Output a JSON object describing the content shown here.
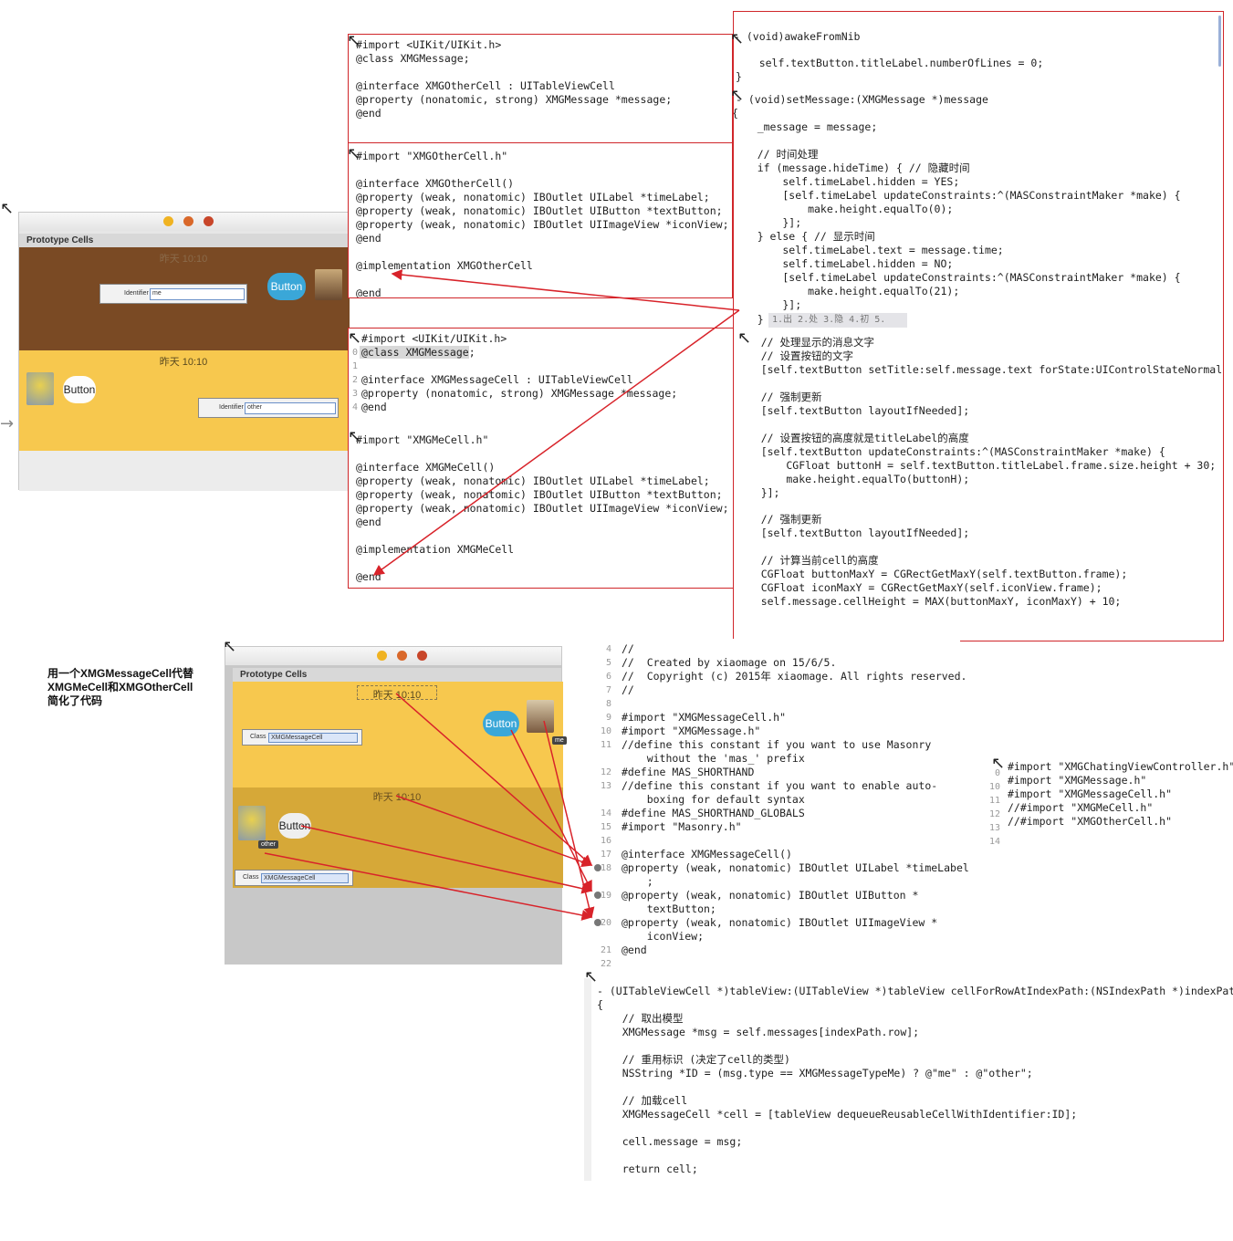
{
  "panel_othercell_header": {
    "lines": [
      "#import <UIKit/UIKit.h>",
      "@class XMGMessage;",
      "",
      "@interface XMGOtherCell : UITableViewCell",
      "@property (nonatomic, strong) XMGMessage *message;",
      "@end"
    ]
  },
  "panel_othercell_impl": {
    "lines": [
      "#import \"XMGOtherCell.h\"",
      "",
      "@interface XMGOtherCell()",
      "@property (weak, nonatomic) IBOutlet UILabel *timeLabel;",
      "@property (weak, nonatomic) IBOutlet UIButton *textButton;",
      "@property (weak, nonatomic) IBOutlet UIImageView *iconView;",
      "@end",
      "",
      "@implementation XMGOtherCell",
      "",
      "@end"
    ]
  },
  "panel_mecell": {
    "lines": [
      "#import <UIKit/UIKit.h>",
      "@class XMGMessage;",
      "",
      "@interface XMGMessageCell : UITableViewCell",
      "@property (nonatomic, strong) XMGMessage *message;",
      "@end",
      "",
      "#import \"XMGMeCell.h\"",
      "",
      "@interface XMGMeCell()",
      "@property (weak, nonatomic) IBOutlet UILabel *timeLabel;",
      "@property (weak, nonatomic) IBOutlet UIButton *textButton;",
      "@property (weak, nonatomic) IBOutlet UIImageView *iconView;",
      "@end",
      "",
      "@implementation XMGMeCell",
      "",
      "@end"
    ],
    "gutter": [
      "0",
      "1",
      "2",
      "3",
      "4"
    ]
  },
  "panel_right": {
    "lines": [
      "- (void)awakeFromNib",
      "    self.textButton.titleLabel.numberOfLines = 0;",
      "}",
      "- (void)setMessage:(XMGMessage *)message",
      "{",
      "    _message = message;",
      "",
      "    // 时间处理",
      "    if (message.hideTime) { // 隐藏时间",
      "        self.timeLabel.hidden = YES;",
      "        [self.timeLabel updateConstraints:^(MASConstraintMaker *make) {",
      "            make.height.equalTo(0);",
      "        }];",
      "    } else { // 显示时间",
      "        self.timeLabel.text = message.time;",
      "        self.timeLabel.hidden = NO;",
      "        [self.timeLabel updateConstraints:^(MASConstraintMaker *make) {",
      "            make.height.equalTo(21);",
      "        }];",
      "    }",
      "    // 处理显示的消息文字",
      "    // 设置按钮的文字",
      "    [self.textButton setTitle:self.message.text forState:UIControlStateNormal];",
      "",
      "    // 强制更新",
      "    [self.textButton layoutIfNeeded];",
      "",
      "    // 设置按钮的高度就是titleLabel的高度",
      "    [self.textButton updateConstraints:^(MASConstraintMaker *make) {",
      "        CGFloat buttonH = self.textButton.titleLabel.frame.size.height + 30;",
      "        make.height.equalTo(buttonH);",
      "    }];",
      "",
      "    // 强制更新",
      "    [self.textButton layoutIfNeeded];",
      "",
      "    // 计算当前cell的高度",
      "    CGFloat buttonMaxY = CGRectGetMaxY(self.textButton.frame);",
      "    CGFloat iconMaxY = CGRectGetMaxY(self.iconView.frame);",
      "    self.message.cellHeight = MAX(buttonMaxY, iconMaxY) + 10;",
      "}"
    ],
    "popup": "1.出 2.处 3.隐 4.初 5."
  },
  "ib_top": {
    "header": "Prototype Cells",
    "brown_time": "昨天 10:10",
    "yellow_time": "昨天 10:10",
    "identifier_label": "Identifier",
    "identifier_me": "me",
    "identifier_other": "other",
    "button_label": "Button"
  },
  "ib_bottom": {
    "header": "Prototype Cells",
    "time_top": "昨天 10:10",
    "time_bottom": "昨天 10:10",
    "class_label": "Class",
    "class_value": "XMGMessageCell",
    "button_label": "Button",
    "tag_me": "me",
    "tag_other": "other"
  },
  "caption": {
    "line1": "用一个XMGMessageCell代替",
    "line2": "XMGMeCell和XMGOtherCell",
    "line3": "简化了代码"
  },
  "panel_messagecell": {
    "lines": [
      "//",
      "//  Created by xiaomage on 15/6/5.",
      "//  Copyright (c) 2015年 xiaomage. All rights reserved.",
      "//",
      "",
      "#import \"XMGMessageCell.h\"",
      "#import \"XMGMessage.h\"",
      "//define this constant if you want to use Masonry",
      "    without the 'mas_' prefix",
      "#define MAS_SHORTHAND",
      "//define this constant if you want to enable auto-",
      "    boxing for default syntax",
      "#define MAS_SHORTHAND_GLOBALS",
      "#import \"Masonry.h\"",
      "",
      "@interface XMGMessageCell()",
      "@property (weak, nonatomic) IBOutlet UILabel *timeLabel",
      "    ;",
      "@property (weak, nonatomic) IBOutlet UIButton *",
      "    textButton;",
      "@property (weak, nonatomic) IBOutlet UIImageView *",
      "    iconView;",
      "@end"
    ],
    "gutter": [
      "4",
      "5",
      "6",
      "7",
      "8",
      "9",
      "10",
      "11",
      "",
      "12",
      "13",
      "",
      "14",
      "15",
      "16",
      "17",
      "18",
      "",
      "19",
      "",
      "20",
      "",
      "21",
      "22"
    ]
  },
  "panel_imports": {
    "lines": [
      "#import \"XMGChatingViewController.h\"",
      "#import \"XMGMessage.h\"",
      "#import \"XMGMessageCell.h\"",
      "//#import \"XMGMeCell.h\"",
      "//#import \"XMGOtherCell.h\""
    ],
    "gutter": [
      "0",
      "10",
      "11",
      "12",
      "13",
      "14"
    ]
  },
  "panel_datasource": {
    "lines": [
      "- (UITableViewCell *)tableView:(UITableView *)tableView cellForRowAtIndexPath:(NSIndexPath *)indexPath",
      "{",
      "    // 取出模型",
      "    XMGMessage *msg = self.messages[indexPath.row];",
      "",
      "    // 重用标识 (决定了cell的类型)",
      "    NSString *ID = (msg.type == XMGMessageTypeMe) ? @\"me\" : @\"other\";",
      "",
      "    // 加载cell",
      "    XMGMessageCell *cell = [tableView dequeueReusableCellWithIdentifier:ID];",
      "",
      "    cell.message = msg;",
      "",
      "    return cell;"
    ]
  },
  "colors": {
    "frame_red": "#d0262a",
    "arrow_red": "#d8232a",
    "brown_cell": "#7a4a24",
    "yellow_cell": "#f7c84e",
    "button_blue": "#3aa7d8"
  }
}
